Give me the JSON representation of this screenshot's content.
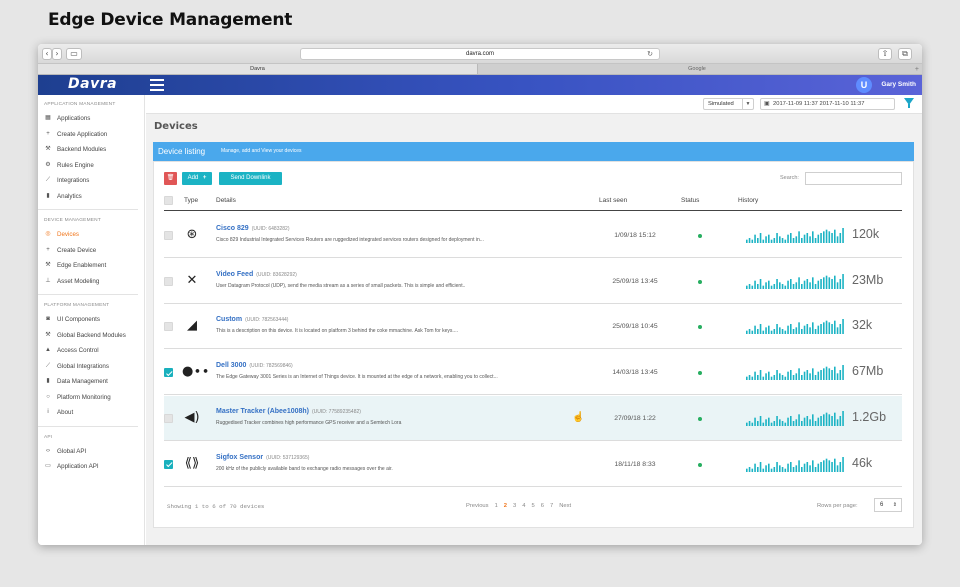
{
  "page_title": "Edge Device Management",
  "browser": {
    "url": "davra.com",
    "tabs": [
      "Davra",
      "Google"
    ]
  },
  "header": {
    "logo": "Davra",
    "user_initial": "U",
    "user_name": "Gary Smith"
  },
  "sidebar": {
    "sections": [
      {
        "title": "APPLICATION MANAGEMENT",
        "items": [
          {
            "label": "Applications",
            "icon": "grid-icon"
          },
          {
            "label": "Create Application",
            "icon": "plus-icon"
          },
          {
            "label": "Backend Modules",
            "icon": "wrench-icon"
          },
          {
            "label": "Rules Engine",
            "icon": "gears-icon"
          },
          {
            "label": "Integrations",
            "icon": "plug-icon"
          },
          {
            "label": "Analytics",
            "icon": "bar-chart-icon"
          }
        ]
      },
      {
        "title": "DEVICE MANAGEMENT",
        "items": [
          {
            "label": "Devices",
            "icon": "devices-icon",
            "active": true
          },
          {
            "label": "Create Device",
            "icon": "plus-icon"
          },
          {
            "label": "Edge Enablement",
            "icon": "wrench-icon"
          },
          {
            "label": "Asset Modeling",
            "icon": "sitemap-icon"
          }
        ]
      },
      {
        "title": "PLATFORM MANAGEMENT",
        "items": [
          {
            "label": "UI Components",
            "icon": "camera-icon"
          },
          {
            "label": "Global Backend Modules",
            "icon": "wrench-icon"
          },
          {
            "label": "Access Control",
            "icon": "lock-icon"
          },
          {
            "label": "Global Integrations",
            "icon": "plug-icon"
          },
          {
            "label": "Data Management",
            "icon": "bar-chart-icon"
          },
          {
            "label": "Platform Monitoring",
            "icon": "search-icon"
          },
          {
            "label": "About",
            "icon": "info-icon"
          }
        ]
      },
      {
        "title": "API",
        "items": [
          {
            "label": "Global API",
            "icon": "code-icon"
          },
          {
            "label": "Application API",
            "icon": "window-icon"
          }
        ]
      }
    ]
  },
  "topbar": {
    "mode": "Simulated",
    "date_range": "2017-11-09 11:37  2017-11-10 11:37"
  },
  "main": {
    "title": "Devices",
    "panel_title": "Device listing",
    "panel_subtitle": "Manage, add and View your devices",
    "add_label": "Add",
    "send_label": "Send Downlink",
    "search_label": "Search:",
    "columns": [
      "Type",
      "Details",
      "Last seen",
      "Status",
      "History"
    ]
  },
  "devices": [
    {
      "name": "Cisco 829",
      "uuid": "(UUID: 6483282)",
      "desc": "Cisco 829 Industrial Integrated Services Routers are ruggedized integrated services routers designed for deployment in...",
      "last_seen": "1/09/18 15:12",
      "history": "120k",
      "icon": "router-icon",
      "glyph": "⊛",
      "checked": false
    },
    {
      "name": "Video Feed",
      "uuid": "(UUID: 83628292)",
      "desc": "User Datagram Protocol (UDP), send the media stream as a series of small packets. This is simple and efficient..",
      "last_seen": "25/09/18 13:45",
      "history": "23Mb",
      "icon": "tools-icon",
      "glyph": "✕",
      "checked": false
    },
    {
      "name": "Custom",
      "uuid": "(UUID: 782563444)",
      "desc": "This is a description on this device. It is located on platform 3 behind the coke mmachine. Ask Tom for keys....",
      "last_seen": "25/09/18 10:45",
      "history": "32k",
      "icon": "camera-icon",
      "glyph": "◢",
      "checked": false
    },
    {
      "name": "Dell 3000",
      "uuid": "(UUID: 782569846)",
      "desc": "The Edge Gateway 3001 Series is an Internet of Things device. It is mounted at the edge of a network, enabling you to collect...",
      "last_seen": "14/03/18 13:45",
      "history": "67Mb",
      "icon": "network-icon",
      "glyph": "●∙∙",
      "checked": true
    },
    {
      "name": "Master Tracker (Abee1008h)",
      "uuid": "(UUID: 77589235482)",
      "desc": "Ruggedised Tracker combines high performance GPS receiver and a Semtech Lora",
      "last_seen": "27/09/18 1:22",
      "history": "1.2Gb",
      "icon": "speaker-icon",
      "glyph": "◀)",
      "checked": false
    },
    {
      "name": "Sigfox Sensor",
      "uuid": "(UUID: 537129365)",
      "desc": "200 kHz of the publicly available band to exchange radio messages over the air.",
      "last_seen": "18/11/18 8:33",
      "history": "46k",
      "icon": "sensor-icon",
      "glyph": "⟪⟫",
      "checked": true
    }
  ],
  "spark_values": [
    2,
    3,
    2,
    5,
    3,
    6,
    2,
    4,
    5,
    2,
    3,
    6,
    4,
    3,
    2,
    5,
    6,
    3,
    4,
    7,
    3,
    5,
    6,
    4,
    7,
    3,
    5,
    6,
    7,
    8,
    7,
    6,
    8,
    4,
    6,
    9
  ],
  "footer": {
    "showing": "Showing 1 to 6 of 70 devices",
    "previous": "Previous",
    "pages": [
      "1",
      "2",
      "3",
      "4",
      "5",
      "6",
      "7"
    ],
    "current_page": "2",
    "next": "Next",
    "rows_label": "Rows per page:",
    "rows_value": "6"
  },
  "colors": {
    "accent": "#1bb3c4",
    "brand": "#2a4aa8",
    "active": "#f0751a",
    "status_ok": "#27ae60"
  }
}
